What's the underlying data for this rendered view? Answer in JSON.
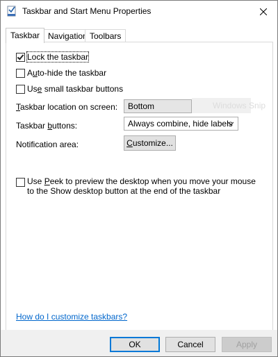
{
  "window": {
    "title": "Taskbar and Start Menu Properties"
  },
  "tabs": [
    {
      "label": "Taskbar"
    },
    {
      "label": "Navigation"
    },
    {
      "label": "Toolbars"
    }
  ],
  "options": {
    "lock": {
      "label": "Lock the taskbar",
      "checked": true
    },
    "autohide": {
      "prefix": "A",
      "hotkey": "u",
      "rest": "to-hide the taskbar",
      "checked": false
    },
    "small": {
      "prefix": "Us",
      "hotkey": "e",
      "rest": " small taskbar buttons",
      "checked": false
    }
  },
  "settings": {
    "location": {
      "label_hotkey": "T",
      "label_rest": "askbar location on screen:",
      "value": "Bottom"
    },
    "buttons": {
      "label_prefix": "Taskbar ",
      "label_hotkey": "b",
      "label_rest": "uttons:",
      "value": "Always combine, hide labels"
    },
    "notification": {
      "label": "Notification area:",
      "button_hotkey": "C",
      "button_rest": "ustomize..."
    }
  },
  "peek": {
    "prefix": "Use ",
    "hotkey": "P",
    "rest": "eek to preview the desktop when you move your mouse to the Show desktop button at the end of the taskbar",
    "checked": false
  },
  "help_link": "How do I customize taskbars?",
  "watermark": "Windows Snip",
  "buttons": {
    "ok": "OK",
    "cancel": "Cancel",
    "apply": "Apply"
  },
  "icons": {
    "app": "taskbar-properties-icon",
    "close": "close-icon",
    "dropdown": "chevron-down-icon"
  }
}
